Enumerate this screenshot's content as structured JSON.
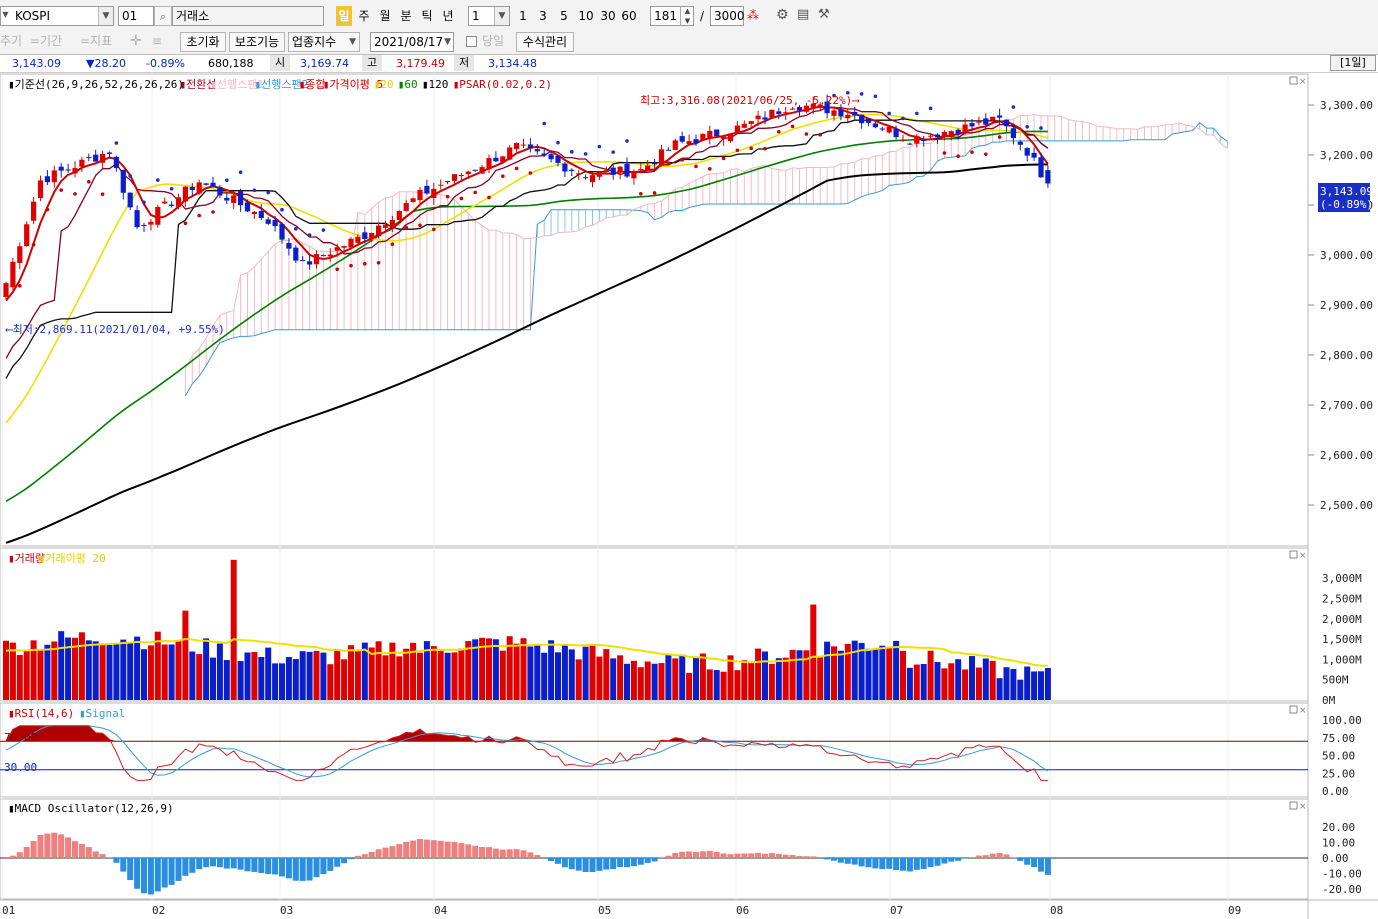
{
  "toolbar": {
    "symbol": "KOSPI",
    "code": "01",
    "market": "거래소",
    "periods": [
      "일",
      "주",
      "월",
      "분",
      "틱",
      "년"
    ],
    "active_period": "일",
    "interval_value": "1",
    "interval_buttons": [
      "1",
      "3",
      "5",
      "10",
      "30",
      "60"
    ],
    "display_count": "181",
    "total_count": "3000"
  },
  "toolbar2": {
    "disabled_tabs": [
      "추기",
      "=기간",
      "=지표"
    ],
    "reset_label": "초기화",
    "aux_label": "보조기능",
    "sector_label": "업종지수",
    "date": "2021/08/17",
    "same_day_label": "당일",
    "formula_label": "수식관리"
  },
  "quote": {
    "close": "3,143.09",
    "change": "▼28.20",
    "pct": "-0.89%",
    "volume": "680,188",
    "open_label": "시",
    "open": "3,169.74",
    "high_label": "고",
    "high": "3,179.49",
    "low_label": "저",
    "low": "3,134.48",
    "period_badge": "[1일]"
  },
  "legend_price": [
    {
      "text": "▮기준선(26,9,26,52,26,26,26)",
      "color": "#000000"
    },
    {
      "text": "▮전환선",
      "color": "#b0002a"
    },
    {
      "text": "▮선행스팬1",
      "color": "#f5b8c0"
    },
    {
      "text": "▮선행스팬2",
      "color": "#3a9ad9"
    },
    {
      "text": "▮종합",
      "color": "#d00000"
    },
    {
      "text": "▮가격이평 5",
      "color": "#d00000"
    },
    {
      "text": "▮20",
      "color": "#e6d000"
    },
    {
      "text": "▮60",
      "color": "#008000"
    },
    {
      "text": "▮120",
      "color": "#000000"
    },
    {
      "text": "▮PSAR(0.02,0.2)",
      "color": "#d00000"
    }
  ],
  "annotations": {
    "high": "최고:3,316.08(2021/06/25, -5.22%)⟶",
    "low": "⟵최저:2,869.11(2021/01/04, +9.55%)"
  },
  "price_axis": [
    "3,300.00",
    "3,200.00",
    "3,100.00",
    "3,000.00",
    "2,900.00",
    "2,800.00",
    "2,700.00",
    "2,600.00",
    "2,500.00"
  ],
  "price_tag": {
    "value": "3,143.09",
    "pct": "(-0.89%)"
  },
  "legend_volume": [
    {
      "text": "▮거래량",
      "color": "#d00000"
    },
    {
      "text": "▮거래이평 20",
      "color": "#e6d000"
    }
  ],
  "volume_axis": [
    "3,000M",
    "2,500M",
    "2,000M",
    "1,500M",
    "1,000M",
    "500M",
    "0M"
  ],
  "legend_rsi": [
    {
      "text": "▮RSI(14,6)",
      "color": "#d00000"
    },
    {
      "text": "▮Signal",
      "color": "#3a9ad9"
    }
  ],
  "rsi_axis": [
    "100.00",
    "75.00",
    "50.00",
    "25.00",
    "0.00"
  ],
  "rsi_levels": {
    "upper": "70.00",
    "lower": "30.00"
  },
  "legend_macd": [
    {
      "text": "▮MACD Oscillator(12,26,9)",
      "color": "#000000"
    }
  ],
  "macd_axis": [
    "20.00",
    "10.00",
    "0.00",
    "-10.00",
    "-20.00"
  ],
  "x_axis": [
    "01",
    "02",
    "03",
    "04",
    "05",
    "06",
    "07",
    "08",
    "09"
  ],
  "colors": {
    "up": "#e00000",
    "down": "#0a1ecc",
    "ma20": "#f0e000",
    "ma60": "#008000",
    "ma120": "#000000",
    "span2": "#3a9ad9",
    "cloud": "#f7b9c3",
    "psar_up": "#d00000",
    "psar_down": "#1a2fc8",
    "macd_pos": "#f08080",
    "macd_neg": "#2a8fe0",
    "rsi_line": "#d02020"
  },
  "chart_data": {
    "type": "candlestick",
    "price_range": [
      2430,
      3350
    ],
    "anchors": [
      {
        "x": "2021-01-04",
        "close": 2944
      },
      {
        "x": "2021-01-11",
        "close": 3149
      },
      {
        "x": "2021-01-25",
        "close": 3208
      },
      {
        "x": "2021-02-01",
        "close": 3056
      },
      {
        "x": "2021-02-15",
        "close": 3147
      },
      {
        "x": "2021-03-02",
        "close": 3070
      },
      {
        "x": "2021-03-09",
        "close": 2980
      },
      {
        "x": "2021-03-22",
        "close": 3040
      },
      {
        "x": "2021-04-05",
        "close": 3120
      },
      {
        "x": "2021-04-26",
        "close": 3216
      },
      {
        "x": "2021-05-12",
        "close": 3161
      },
      {
        "x": "2021-05-24",
        "close": 3170
      },
      {
        "x": "2021-06-01",
        "close": 3221
      },
      {
        "x": "2021-06-15",
        "close": 3258
      },
      {
        "x": "2021-06-25",
        "close": 3302
      },
      {
        "x": "2021-07-07",
        "close": 3285
      },
      {
        "x": "2021-07-20",
        "close": 3232
      },
      {
        "x": "2021-08-06",
        "close": 3270
      },
      {
        "x": "2021-08-12",
        "close": 3208
      },
      {
        "x": "2021-08-17",
        "close": 3143
      }
    ]
  }
}
